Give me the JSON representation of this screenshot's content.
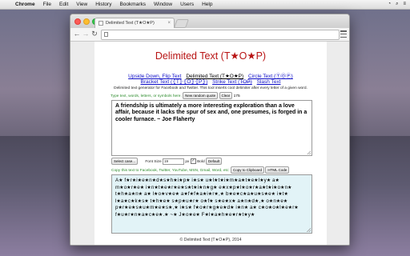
{
  "menubar": {
    "app_name": "Chrome",
    "items": [
      "File",
      "Edit",
      "View",
      "History",
      "Bookmarks",
      "Window",
      "Users",
      "Help"
    ]
  },
  "browser": {
    "tab_title": "Delimited Text (T★O★P)",
    "tab_close": "×",
    "back": "←",
    "forward": "→",
    "reload": "↻"
  },
  "page": {
    "title": "Delimited Text (T★O★P)",
    "links_row1": [
      {
        "label": "Upside Down, Flip Text",
        "current": false
      },
      {
        "label": "Delimited Text (T★O★P)",
        "current": true
      },
      {
        "label": "Circle Text (ⓉⓄⓅ)",
        "current": false
      }
    ],
    "links_row2": [
      {
        "label": "Bracket Text (⦃T⦄⦃O⦄⦃P⦄)",
        "current": false
      },
      {
        "label": "Strike Text (T̶O̶P̶)",
        "current": false
      },
      {
        "label": "Slash Text",
        "current": false
      }
    ],
    "description": "Delimited text generator for Facebook and Twitter. This tool inserts cool delimiter after every letter of a given word.",
    "input_prompt": "Type text, words, letters, or symbols here.",
    "new_quote_button": "New random quote",
    "clear_button": "Clear",
    "char_count": "175",
    "input_text": "A friendship is ultimately a more interesting exploration than a love affair, because it lacks the spur of sex and, one presumes, is forged in a cooler furnace. ~ Joe Flaherty",
    "select_case_button": "Select case...",
    "font_size_label": "Font Size",
    "font_size_value": "19",
    "font_size_unit": "px",
    "bold_checkbox": "✓",
    "bold_label": "Bold",
    "default_button": "Default",
    "copy_prompt": "Copy this text to Facebook, Twitter, YouTube, MSN, Gmail, Word, etc:",
    "copy_clipboard_button": "Copy to Clipboard",
    "html_code_button": "HTML Code",
    "output_text": "A★ f★r★i★e★n★d★s★h★i★p★ i★s★ u★l★t★i★m★a★t★e★l★y★ a★ m★o★r★e★ i★n★t★e★r★e★s★t★i★n★g★ e★x★p★l★o★r★a★t★i★o★n★ t★h★a★n★ a★ l★o★v★e★ a★f★f★a★i★r★,★ b★e★c★a★u★s★e★ i★t★ l★a★c★k★s★ t★h★e★ s★p★u★r★ o★f★ s★e★x★ a★n★d★,★ o★n★e★ p★r★e★s★u★m★e★s★,★ i★s★ f★o★r★g★e★d★ i★n★ a★ c★o★o★l★e★r★ f★u★r★n★a★c★e★.★ ~★ J★o★e★ F★l★a★h★e★r★t★y★",
    "footer": "© Delimited Text (T★O★P), 2014"
  }
}
